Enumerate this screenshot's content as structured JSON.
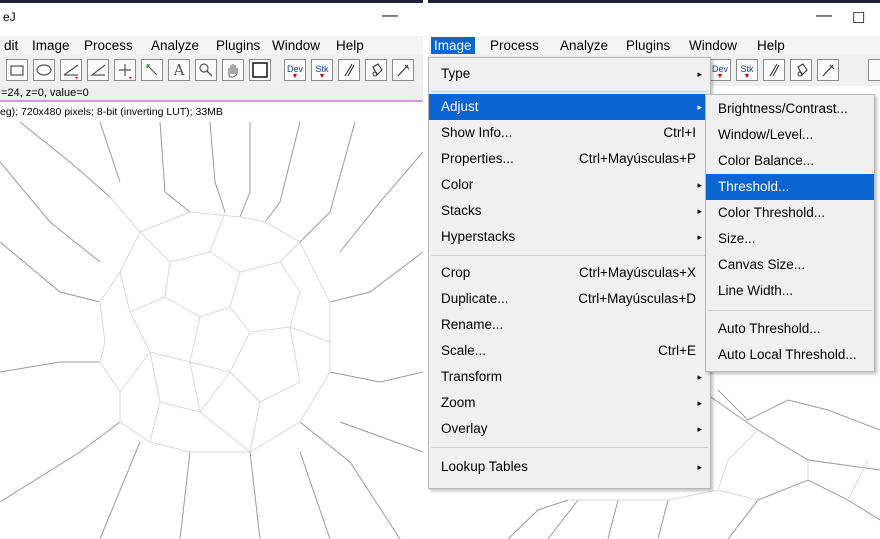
{
  "left_window": {
    "title_fragment": "eJ",
    "minimize_glyph": "—",
    "menu": [
      "dit",
      "Image",
      "Process",
      "Analyze",
      "Plugins",
      "Window",
      "Help"
    ],
    "tools": [
      "rectangle-tool",
      "oval-tool",
      "line-tool",
      "angle-tool",
      "point-tool",
      "wand-tool",
      "text-tool",
      "magnifier-tool",
      "hand-tool",
      "color-picker-tool",
      "developer-menu",
      "stack-menu",
      "brush-tool",
      "fill-tool",
      "pencil-tool"
    ],
    "tool_text": {
      "text": "A",
      "dev": "Dev",
      "stk": "Stk"
    },
    "status": "=24, z=0, value=0",
    "file_info": "eg); 720x480 pixels; 8-bit (inverting LUT); 33MB"
  },
  "right_window": {
    "minimize_glyph": "—",
    "maximize_glyph": "☐",
    "menu": [
      "Image",
      "Process",
      "Analyze",
      "Plugins",
      "Window",
      "Help"
    ],
    "active_menu": "Image",
    "tool_text": {
      "dev": "Dev",
      "stk": "Stk"
    },
    "image_menu": [
      {
        "label": "Type",
        "submenu": true
      },
      {
        "separator": true
      },
      {
        "label": "Adjust",
        "submenu": true,
        "highlighted": true
      },
      {
        "label": "Show Info...",
        "shortcut": "Ctrl+I"
      },
      {
        "label": "Properties...",
        "shortcut": "Ctrl+Mayúsculas+P"
      },
      {
        "label": "Color",
        "submenu": true
      },
      {
        "label": "Stacks",
        "submenu": true
      },
      {
        "label": "Hyperstacks",
        "submenu": true
      },
      {
        "separator": true
      },
      {
        "label": "Crop",
        "shortcut": "Ctrl+Mayúsculas+X"
      },
      {
        "label": "Duplicate...",
        "shortcut": "Ctrl+Mayúsculas+D"
      },
      {
        "label": "Rename..."
      },
      {
        "label": "Scale...",
        "shortcut": "Ctrl+E"
      },
      {
        "label": "Transform",
        "submenu": true
      },
      {
        "label": "Zoom",
        "submenu": true
      },
      {
        "label": "Overlay",
        "submenu": true
      },
      {
        "separator": true
      },
      {
        "label": "Lookup Tables",
        "submenu": true
      }
    ],
    "adjust_submenu": [
      {
        "label": "Brightness/Contrast..."
      },
      {
        "label": "Window/Level..."
      },
      {
        "label": "Color Balance..."
      },
      {
        "label": "Threshold...",
        "highlighted": true
      },
      {
        "label": "Color Threshold..."
      },
      {
        "label": "Size..."
      },
      {
        "label": "Canvas Size..."
      },
      {
        "label": "Line Width..."
      },
      {
        "separator": true
      },
      {
        "label": "Auto Threshold..."
      },
      {
        "label": "Auto Local Threshold..."
      }
    ]
  },
  "colors": {
    "highlight": "#0a64d2",
    "menu_bg": "#f0f0f0",
    "progress": "#c99bd6"
  },
  "arrow_glyph": "▸"
}
